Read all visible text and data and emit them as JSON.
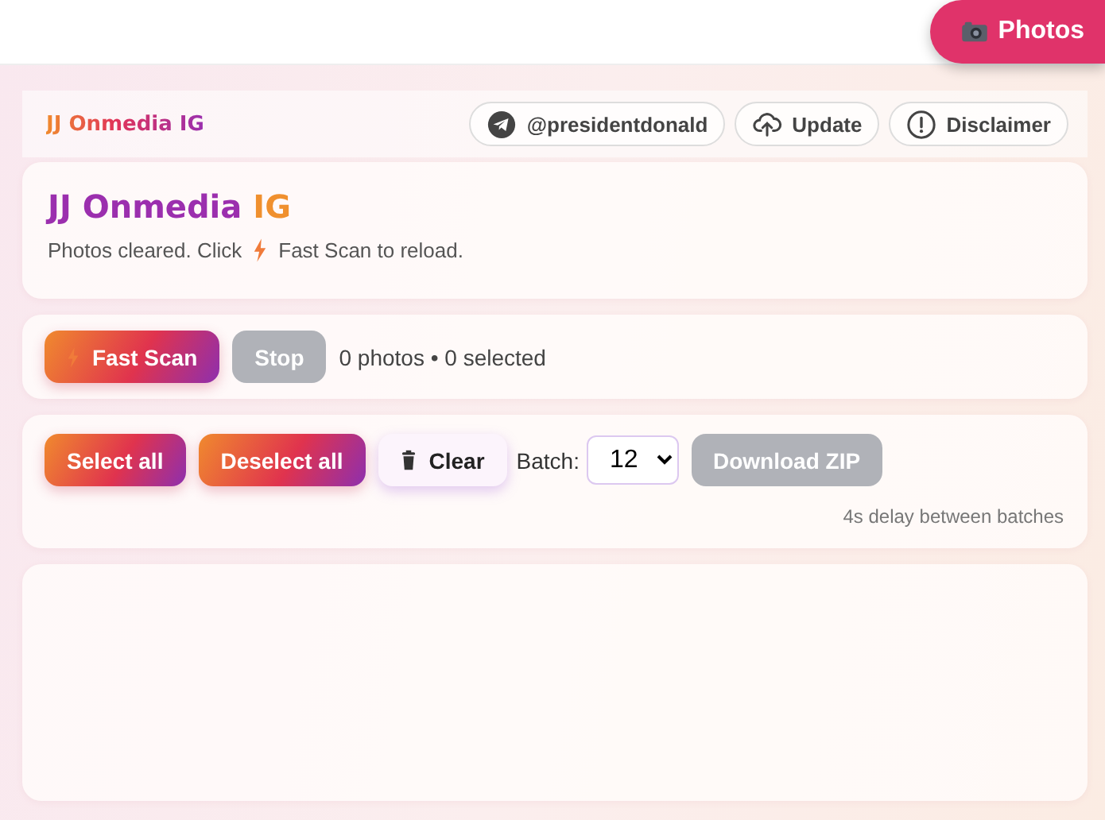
{
  "top_bar": {
    "photos_button": "Photos"
  },
  "header": {
    "brand": "JJ Onmedia IG",
    "links": [
      {
        "kind": "telegram",
        "label": "@presidentdonald"
      },
      {
        "kind": "upload",
        "label": "Update"
      },
      {
        "kind": "alert",
        "label": "Disclaimer"
      }
    ]
  },
  "intro": {
    "title": "JJ Onmedia",
    "title_accent": "IG",
    "status_before": "Photos cleared. Click",
    "status_after": "Fast Scan to reload."
  },
  "scan": {
    "buttons": [
      {
        "kind": "scan",
        "label": "Fast Scan"
      },
      {
        "kind": "disabled",
        "label": "Stop"
      }
    ],
    "summary": "0 photos • 0 selected"
  },
  "actions": {
    "buttons": [
      {
        "kind": "gradient",
        "label": "Select all"
      },
      {
        "kind": "gradient",
        "label": "Deselect all"
      },
      {
        "kind": "clear",
        "label": "Clear"
      }
    ],
    "batch_label": "Batch:",
    "batch_value": "12",
    "download": {
      "kind": "disabled",
      "label": "Download ZIP"
    },
    "note": "4s delay between batches"
  }
}
